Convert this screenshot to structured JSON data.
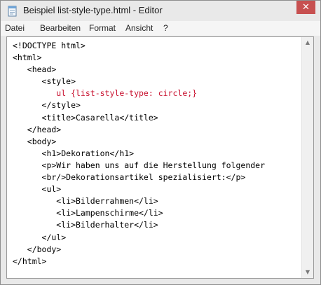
{
  "window": {
    "title": "Beispiel list-style-type.html - Editor",
    "close_glyph": "✕"
  },
  "menu": [
    "Datei",
    "Bearbeiten",
    "Format",
    "Ansicht",
    "?"
  ],
  "code_lines": [
    "<!DOCTYPE html>",
    "<html>",
    "   <head>",
    "      <style>",
    "         ul {list-style-type: circle;}",
    "      </style>",
    "      <title>Casarella</title>",
    "   </head>",
    "   <body>",
    "      <h1>Dekoration</h1>",
    "      <p>Wir haben uns auf die Herstellung folgender",
    "      <br/>Dekorationsartikel spezialisiert:</p>",
    "      <ul>",
    "         <li>Bilderrahmen</li>",
    "         <li>Lampenschirme</li>",
    "         <li>Bilderhalter</li>",
    "      </ul>",
    "   </body>",
    "</html>"
  ],
  "scrollbar": {
    "up": "▲",
    "down": "▼"
  },
  "colors": {
    "highlight": "#c8102e",
    "close_button": "#c75050"
  },
  "icons": {
    "app": "notepad-icon"
  }
}
